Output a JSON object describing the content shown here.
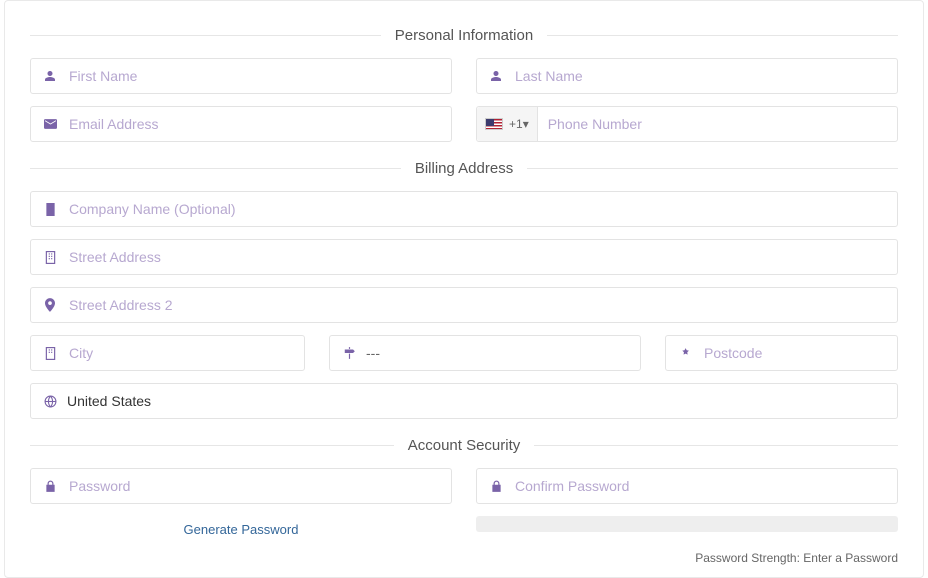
{
  "sections": {
    "personal": "Personal Information",
    "billing": "Billing Address",
    "security": "Account Security"
  },
  "personal": {
    "first_name": {
      "placeholder": "First Name",
      "value": ""
    },
    "last_name": {
      "placeholder": "Last Name",
      "value": ""
    },
    "email": {
      "placeholder": "Email Address",
      "value": ""
    },
    "phone": {
      "placeholder": "Phone Number",
      "value": "",
      "dial_code": "+1",
      "country_iso": "US"
    }
  },
  "billing": {
    "company": {
      "placeholder": "Company Name (Optional)",
      "value": ""
    },
    "street1": {
      "placeholder": "Street Address",
      "value": ""
    },
    "street2": {
      "placeholder": "Street Address 2",
      "value": ""
    },
    "city": {
      "placeholder": "City",
      "value": ""
    },
    "state": {
      "display": "---"
    },
    "postcode": {
      "placeholder": "Postcode",
      "value": ""
    },
    "country": {
      "display": "United States"
    }
  },
  "security": {
    "password": {
      "placeholder": "Password",
      "value": ""
    },
    "confirm": {
      "placeholder": "Confirm Password",
      "value": ""
    },
    "generate_label": "Generate Password",
    "strength_prefix": "Password Strength: ",
    "strength_value": "Enter a Password"
  }
}
